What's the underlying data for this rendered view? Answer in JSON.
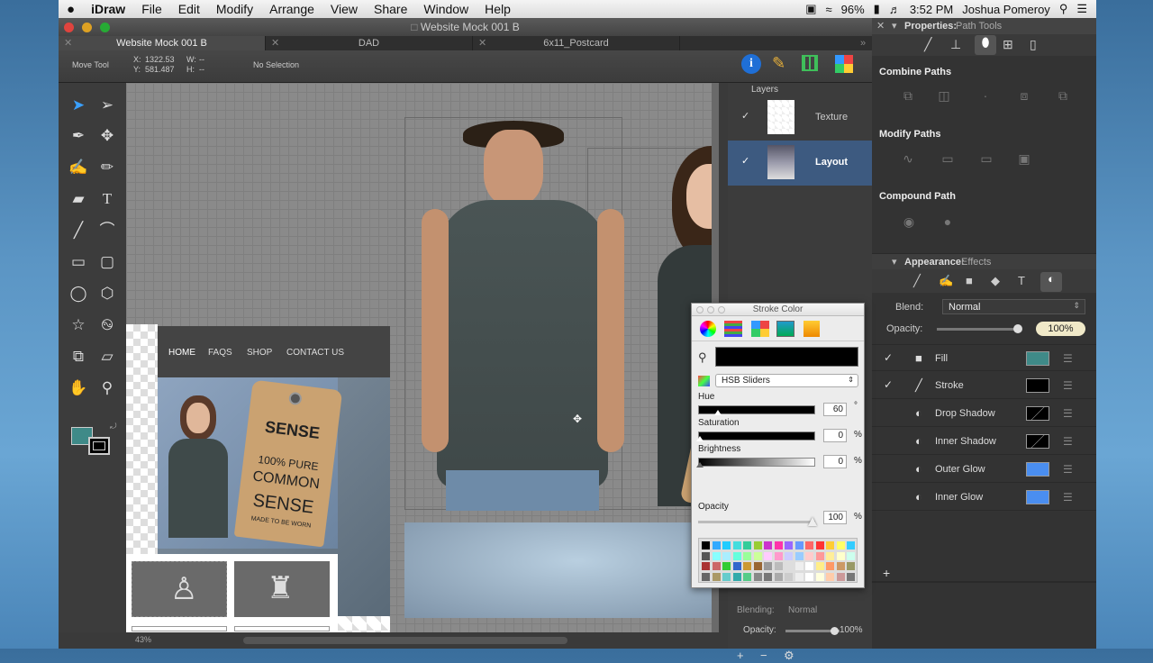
{
  "menubar": {
    "apple": "",
    "app": "iDraw",
    "items": [
      "File",
      "Edit",
      "Modify",
      "Arrange",
      "View",
      "Share",
      "Window",
      "Help"
    ],
    "battery": "96%",
    "time": "3:52 PM",
    "user": "Joshua Pomeroy"
  },
  "window": {
    "title": "Website Mock 001 B",
    "tabs": [
      "Website Mock 001 B",
      "DAD",
      "6x11_Postcard"
    ]
  },
  "toolbar": {
    "tool_name": "Move Tool",
    "x_label": "X:",
    "x_val": "1322.53",
    "y_label": "Y:",
    "y_val": "581.487",
    "w_label": "W:",
    "w_val": "--",
    "h_label": "H:",
    "h_val": "--",
    "selection": "No Selection"
  },
  "layers": {
    "header": "Layers",
    "items": [
      {
        "name": "Texture"
      },
      {
        "name": "Layout"
      }
    ],
    "blending_label": "Blending:",
    "blending_value": "Normal",
    "opacity_label": "Opacity:",
    "opacity_value": "100%"
  },
  "zoom": "43%",
  "mockup": {
    "nav": [
      "HOME",
      "FAQS",
      "SHOP",
      "CONTACT US"
    ],
    "tag_line1": "SENSE",
    "tag_line2": "100% PURE",
    "tag_line3": "COMMON",
    "tag_line4": "SENSE",
    "tag_line5": "MADE TO BE WORN"
  },
  "properties": {
    "title": "Properties:",
    "subtitle": "Path Tools",
    "combine": "Combine Paths",
    "modify": "Modify Paths",
    "compound": "Compound Path",
    "appearance": "Appearance:",
    "effects": "Effects",
    "blend_label": "Blend:",
    "blend_value": "Normal",
    "opacity_label": "Opacity:",
    "opacity_value": "100%",
    "effects_list": [
      {
        "name": "Fill",
        "checked": true,
        "color": "#3f8a88"
      },
      {
        "name": "Stroke",
        "checked": true,
        "color": "#000000"
      },
      {
        "name": "Drop Shadow",
        "checked": false,
        "color": "#000000"
      },
      {
        "name": "Inner Shadow",
        "checked": false,
        "color": "#000000"
      },
      {
        "name": "Outer Glow",
        "checked": false,
        "color": "#4a8ef0"
      },
      {
        "name": "Inner Glow",
        "checked": false,
        "color": "#4a8ef0"
      }
    ]
  },
  "stroke_popup": {
    "title": "Stroke Color",
    "mode": "HSB Sliders",
    "hue_label": "Hue",
    "hue": "60",
    "hue_unit": "°",
    "sat_label": "Saturation",
    "sat": "0",
    "sat_unit": "%",
    "bri_label": "Brightness",
    "bri": "0",
    "bri_unit": "%",
    "opacity_label": "Opacity",
    "opacity": "100",
    "opacity_unit": "%"
  },
  "colors": {
    "accent": "#3f8a88",
    "selected_layer": "#3d5a80"
  }
}
